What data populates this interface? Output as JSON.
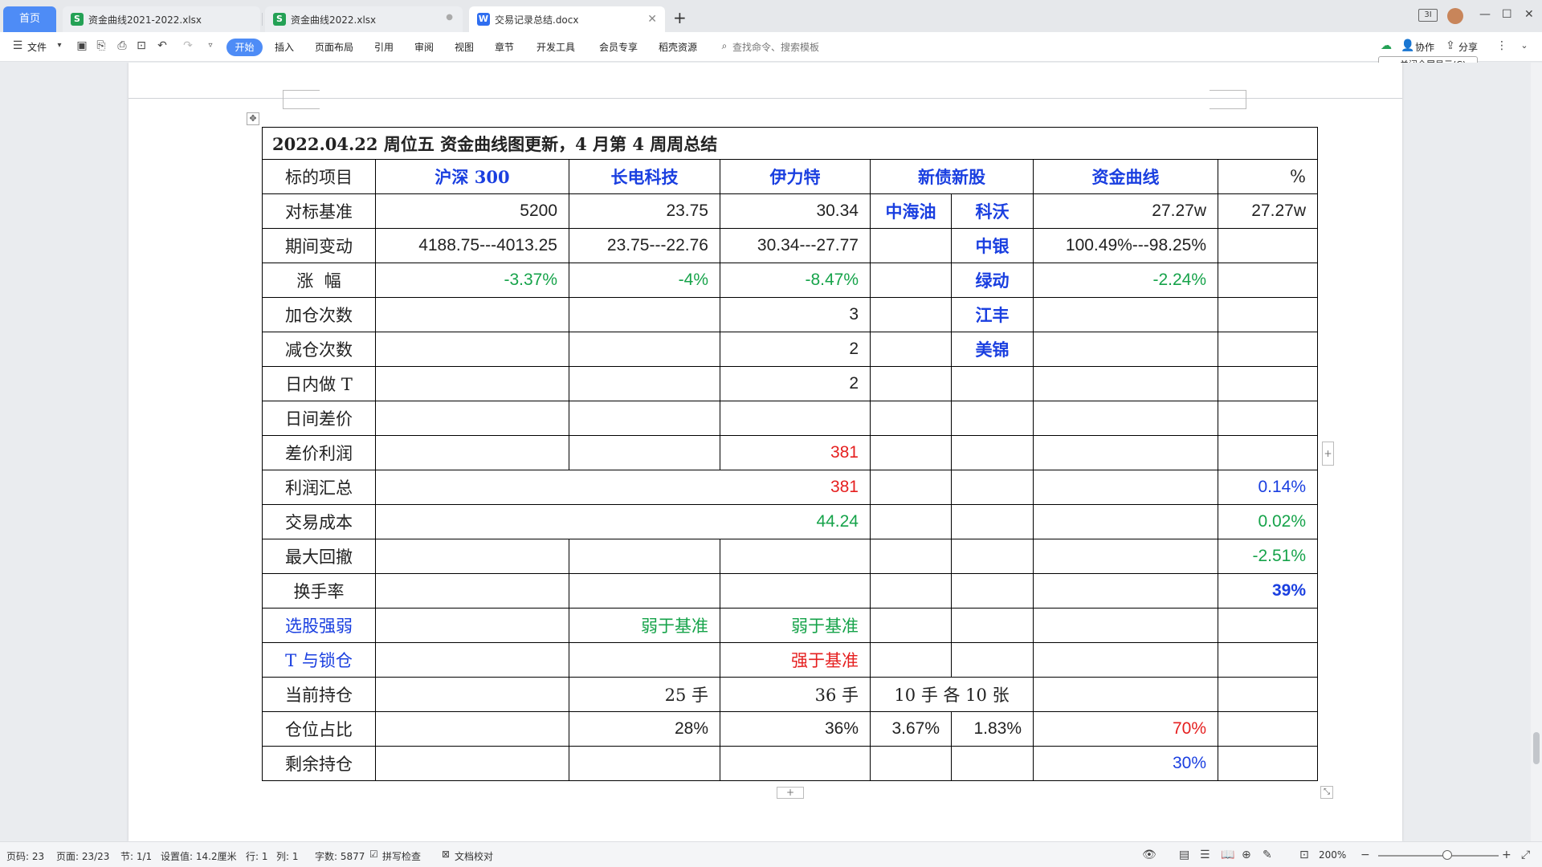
{
  "tabs": {
    "home": "首页",
    "items": [
      {
        "label": "资金曲线2021-2022.xlsx",
        "type": "S"
      },
      {
        "label": "资金曲线2022.xlsx",
        "type": "S"
      },
      {
        "label": "交易记录总结.docx",
        "type": "W"
      }
    ],
    "add": "+"
  },
  "window": {
    "screen_label": "3I",
    "minimize": "—",
    "maximize": "☐",
    "close": "✕"
  },
  "toolbar": {
    "file": "文件",
    "tabs": [
      "开始",
      "插入",
      "页面布局",
      "引用",
      "审阅",
      "视图",
      "章节",
      "开发工具",
      "会员专享",
      "稻壳资源"
    ],
    "search": "查找命令、搜索模板",
    "collab": "协作",
    "share": "分享",
    "tooltip": "关闭全屏显示(C)"
  },
  "table": {
    "title": "2022.04.22  周位五  资金曲线图更新，4 月第 4 周周总结",
    "header": [
      "标的项目",
      "沪深 300",
      "长电科技",
      "伊力特",
      "新债新股",
      "资金曲线",
      "%"
    ],
    "baseline": {
      "label": "对标基准",
      "hs300": "5200",
      "cd": "23.75",
      "ylt": "30.34",
      "zhy": "中海油",
      "kw": "科沃",
      "fund": "27.27w",
      "pct": "27.27w"
    },
    "change": {
      "label": "期间变动",
      "hs300": "4188.75---4013.25",
      "cd": "23.75---22.76",
      "ylt": "30.34---27.77",
      "bond": "中银",
      "fund": "100.49%---98.25%"
    },
    "rise": {
      "label": "涨  幅",
      "hs300": "-3.37%",
      "cd": "-4%",
      "ylt": "-8.47%",
      "bond": "绿动",
      "fund": "-2.24%"
    },
    "add_pos": {
      "label": "加仓次数",
      "ylt": "3",
      "bond": "江丰"
    },
    "reduce_pos": {
      "label": "减仓次数",
      "ylt": "2",
      "bond": "美锦"
    },
    "intraday_t": {
      "label": "日内做 T",
      "ylt": "2"
    },
    "interday": {
      "label": "日间差价"
    },
    "spread_profit": {
      "label": "差价利润",
      "ylt": "381"
    },
    "profit_total": {
      "label": "利润汇总",
      "value": "381",
      "pct": "0.14%"
    },
    "trade_cost": {
      "label": "交易成本",
      "value": "44.24",
      "pct": "0.02%"
    },
    "max_drawdown": {
      "label": "最大回撤",
      "pct": "-2.51%"
    },
    "turnover": {
      "label": "换手率",
      "pct": "39%"
    },
    "stock_pick": {
      "label": "选股强弱",
      "cd": "弱于基准",
      "ylt": "弱于基准"
    },
    "t_lock": {
      "label": "T 与锁仓",
      "ylt": "强于基准"
    },
    "holding": {
      "label": "当前持仓",
      "cd": "25 手",
      "ylt": "36 手",
      "new": "10 手  各 10 张"
    },
    "position_ratio": {
      "label": "仓位占比",
      "cd": "28%",
      "ylt": "36%",
      "zhy": "3.67%",
      "kw": "1.83%",
      "fund": "70%"
    },
    "remaining": {
      "label": "剩余持仓",
      "fund": "30%"
    }
  },
  "statusbar": {
    "page_code": "页码: 23",
    "pages": "页面: 23/23",
    "section": "节: 1/1",
    "setting": "设置值: 14.2厘米",
    "row": "行: 1",
    "col": "列: 1",
    "words": "字数: 5877",
    "spell": "拼写检查",
    "proof": "文档校对",
    "zoom": "200%"
  },
  "colors": {
    "accent": "#4e8cf6",
    "blue_text": "#1a3fe0",
    "green_text": "#16a34a",
    "red_text": "#e51f1f"
  }
}
